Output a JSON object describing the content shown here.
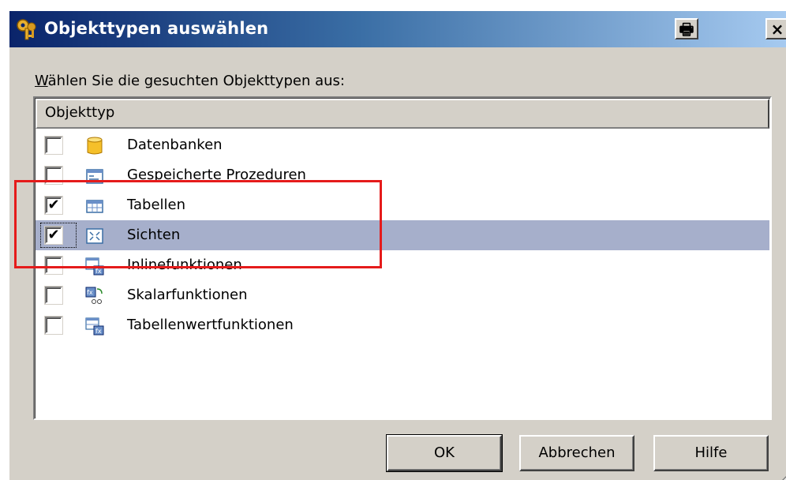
{
  "window": {
    "title": "Objekttypen auswählen",
    "title_icon": "keys-icon"
  },
  "titlebar": {
    "print_glyph": "🖶",
    "close_glyph": "×"
  },
  "prompt": {
    "accel": "W",
    "rest": "ählen Sie die gesuchten Objekttypen aus:"
  },
  "list": {
    "column_header": "Objekttyp",
    "items": [
      {
        "label": "Datenbanken",
        "checked": false,
        "icon": "database-icon"
      },
      {
        "label": "Gespeicherte Prozeduren",
        "checked": false,
        "icon": "stored-procedure-icon"
      },
      {
        "label": "Tabellen",
        "checked": true,
        "icon": "table-icon"
      },
      {
        "label": "Sichten",
        "checked": true,
        "icon": "view-icon",
        "selected": true
      },
      {
        "label": "Inlinefunktionen",
        "checked": false,
        "icon": "inline-function-icon"
      },
      {
        "label": "Skalarfunktionen",
        "checked": false,
        "icon": "scalar-function-icon"
      },
      {
        "label": "Tabellenwertfunktionen",
        "checked": false,
        "icon": "table-valued-function-icon"
      }
    ]
  },
  "buttons": {
    "ok": "OK",
    "cancel": "Abbrechen",
    "help": "Hilfe"
  },
  "colors": {
    "selection": "#a6afcb",
    "highlight_box": "#e51b1b",
    "dialog_face": "#d4d0c8"
  },
  "checkmark": "✔"
}
